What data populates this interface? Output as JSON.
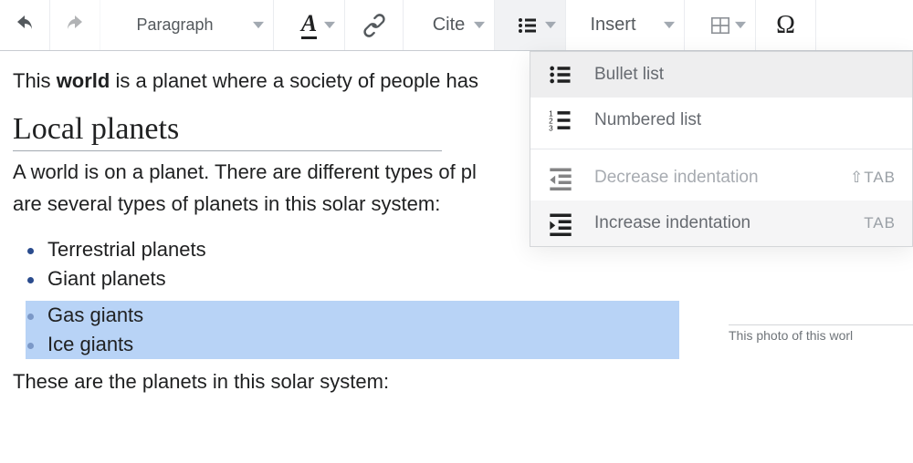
{
  "toolbar": {
    "format_label": "Paragraph",
    "cite_label": "Cite",
    "insert_label": "Insert"
  },
  "list_menu": {
    "bullet": "Bullet list",
    "numbered": "Numbered list",
    "decrease": "Decrease indentation",
    "increase": "Increase indentation",
    "shortcut_decrease": "⇧TAB",
    "shortcut_increase": "TAB"
  },
  "doc": {
    "intro_pre": "This ",
    "intro_bold": "world",
    "intro_post": " is a planet where a society of people has ",
    "heading": "Local planets",
    "body1": "A world is on a planet.  There are different types of pl",
    "body2": "are several types of planets in this solar system:",
    "bullets": {
      "b1": "Terrestrial planets",
      "b2": "Giant planets",
      "b3": "Gas giants",
      "b4": "Ice giants"
    },
    "after_list": "These are the planets in this solar system:",
    "cropped_caption": "This photo of this worl"
  }
}
